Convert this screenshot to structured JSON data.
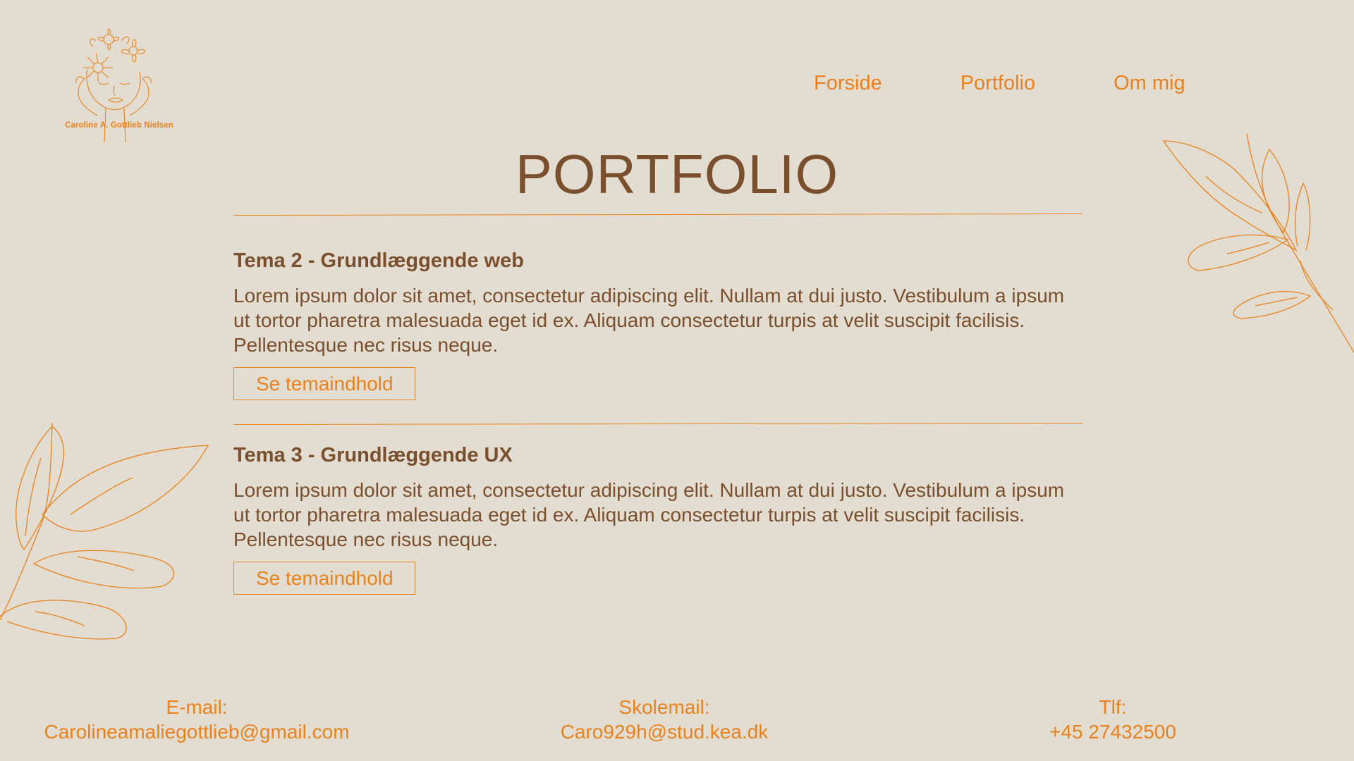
{
  "logo": {
    "name": "Caroline A. Gottlieb Nielsen"
  },
  "nav": {
    "items": [
      "Forside",
      "Portfolio",
      "Om mig"
    ]
  },
  "main": {
    "title": "PORTFOLIO",
    "sections": [
      {
        "heading": "Tema 2 - Grundlæggende web",
        "body": "Lorem ipsum dolor sit amet, consectetur adipiscing elit. Nullam at dui justo. Vestibulum a ipsum ut tortor pharetra malesuada eget id ex. Aliquam consectetur turpis at velit suscipit facilisis. Pellentesque nec risus neque.",
        "button": "Se temaindhold"
      },
      {
        "heading": "Tema 3 - Grundlæggende UX",
        "body": "Lorem ipsum dolor sit amet, consectetur adipiscing elit. Nullam at dui justo. Vestibulum a ipsum ut tortor pharetra malesuada eget id ex. Aliquam consectetur turpis at velit suscipit facilisis. Pellentesque nec risus neque.",
        "button": "Se temaindhold"
      }
    ]
  },
  "footer": {
    "email_label": "E-mail:",
    "email_value": "Carolineamaliegottlieb@gmail.com",
    "school_label": "Skolemail:",
    "school_value": "Caro929h@stud.kea.dk",
    "phone_label": "Tlf:",
    "phone_value": "+45 27432500"
  },
  "colors": {
    "background": "#e2ddd0",
    "accent": "#e8821e",
    "text": "#7a4f2e"
  }
}
